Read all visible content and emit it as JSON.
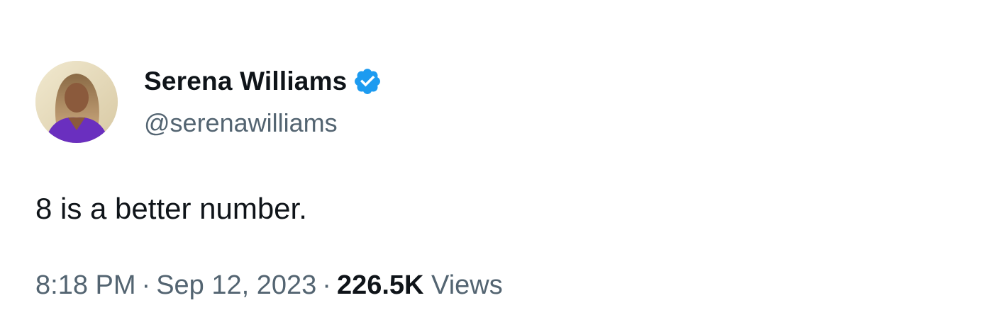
{
  "tweet": {
    "author": {
      "display_name": "Serena Williams",
      "handle": "@serenawilliams",
      "verified": true
    },
    "text": "8 is a better number.",
    "meta": {
      "time": "8:18 PM",
      "separator": "·",
      "date": "Sep 12, 2023",
      "views_count": "226.5K",
      "views_label": "Views"
    }
  },
  "colors": {
    "text_primary": "#0f1419",
    "text_secondary": "#536471",
    "verified_blue": "#1d9bf0",
    "background": "#ffffff"
  },
  "icons": {
    "verified": "verified-badge-icon",
    "avatar": "profile-photo"
  }
}
